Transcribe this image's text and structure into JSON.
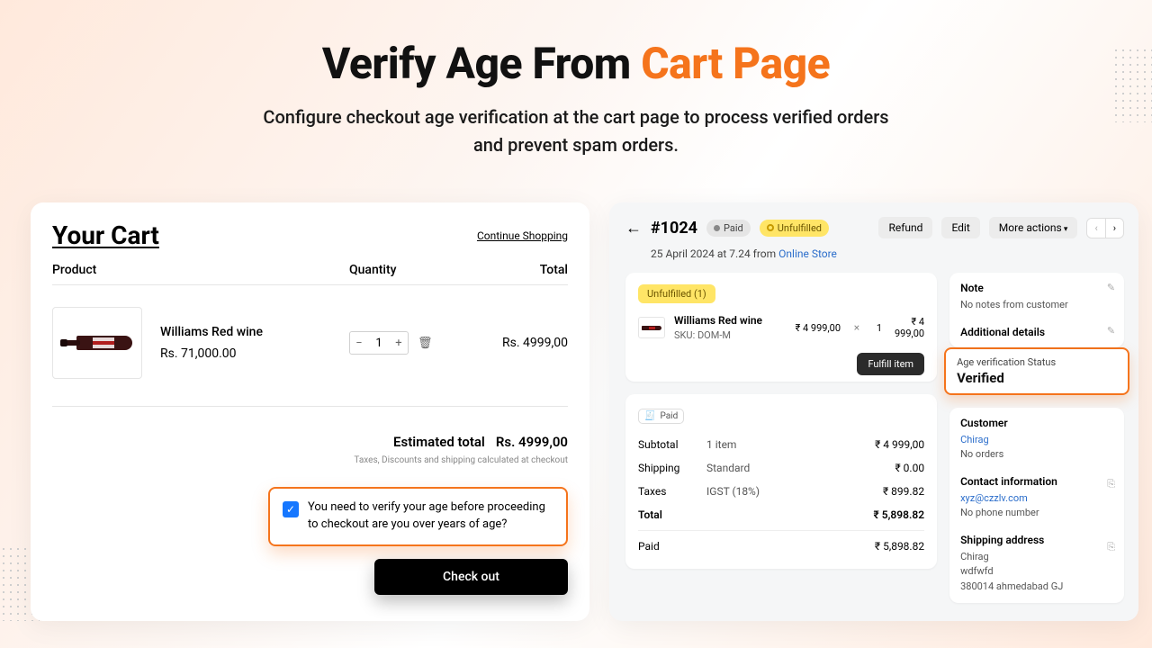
{
  "hero": {
    "title_a": "Verify Age From ",
    "title_b": "Cart Page",
    "subtitle_1": "Configure checkout age verification at the cart page to process verified orders",
    "subtitle_2": "and prevent spam orders."
  },
  "cart": {
    "title": "Your Cart",
    "continue": "Continue Shopping",
    "headers": {
      "product": "Product",
      "quantity": "Quantity",
      "total": "Total"
    },
    "item": {
      "name": "Williams Red wine",
      "price": "Rs. 71,000.00",
      "qty": "1",
      "line_total": "Rs. 4999,00"
    },
    "est_label": "Estimated total",
    "est_value": "Rs. 4999,00",
    "tax_note": "Taxes, Discounts and shipping calculated at checkout",
    "verify_text": "You need to verify your age before proceeding to checkout are you over years of age?",
    "checkout": "Check out"
  },
  "order": {
    "id": "#1024",
    "paid_badge": "Paid",
    "unfulfilled_badge": "Unfulfilled",
    "refund": "Refund",
    "edit": "Edit",
    "more": "More actions",
    "date_pre": "25 April 2024 at 7.24 from ",
    "date_link": "Online Store",
    "panel_unful": "Unfulfilled (1)",
    "line": {
      "name": "Williams Red wine",
      "sku": "SKU: DOM-M",
      "price": "₹ 4 999,00",
      "x": "×",
      "qty": "1",
      "total": "₹ 4 999,00"
    },
    "fulfill": "Fulfill item",
    "paid_chip": "Paid",
    "totals": {
      "subtotal_l": "Subtotal",
      "subtotal_m": "1 item",
      "subtotal_v": "₹ 4 999,00",
      "ship_l": "Shipping",
      "ship_m": "Standard",
      "ship_v": "₹ 0.00",
      "tax_l": "Taxes",
      "tax_m": "IGST (18%)",
      "tax_v": "₹ 899.82",
      "total_l": "Total",
      "total_v": "₹ 5,898.82",
      "paid_l": "Paid",
      "paid_v": "₹ 5,898.82"
    },
    "note": {
      "head": "Note",
      "body": "No notes from customer"
    },
    "add_details": "Additional details",
    "avs": {
      "label": "Age verification Status",
      "value": "Verified"
    },
    "customer": {
      "head": "Customer",
      "name": "Chirag",
      "orders": "No orders"
    },
    "contact": {
      "head": "Contact information",
      "email": "xyz@czzlv.com",
      "phone": "No phone number"
    },
    "shipping": {
      "head": "Shipping address",
      "l1": "Chirag",
      "l2": "wdfwfd",
      "l3": "380014 ahmedabad GJ"
    }
  }
}
